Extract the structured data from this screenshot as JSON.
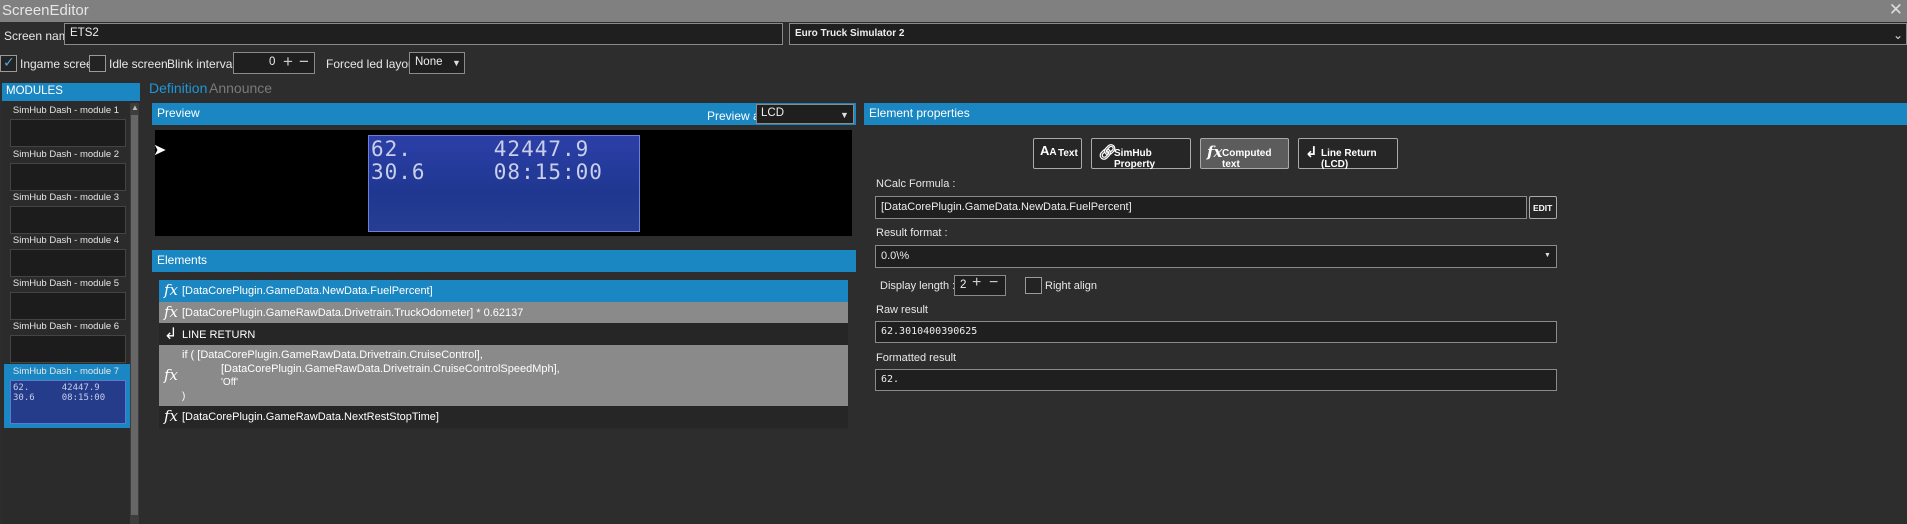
{
  "window": {
    "title": "ScreenEditor",
    "close_glyph": "✕"
  },
  "row1": {
    "screen_name_label": "Screen name",
    "screen_name_value": "ETS2",
    "game_value": "Euro Truck Simulator 2"
  },
  "row2": {
    "ingame_label": "Ingame screen",
    "ingame_checked": true,
    "idle_label": "Idle screen",
    "idle_checked": false,
    "blink_label": "Blink interval",
    "blink_value": "0",
    "forced_led_label": "Forced led layout",
    "forced_led_value": "None"
  },
  "modules": {
    "header": "MODULES",
    "items": [
      {
        "name": "SimHub Dash - module 1"
      },
      {
        "name": "SimHub Dash - module 2"
      },
      {
        "name": "SimHub Dash - module 3"
      },
      {
        "name": "SimHub Dash - module 4"
      },
      {
        "name": "SimHub Dash - module 5"
      },
      {
        "name": "SimHub Dash - module 6"
      },
      {
        "name": "SimHub Dash - module 7",
        "line1": "62.      42447.9",
        "line2": "30.6     08:15:00"
      }
    ]
  },
  "tabs": {
    "definition": "Definition",
    "announce": "Announce"
  },
  "preview": {
    "header": "Preview",
    "preview_as_label": "Preview as",
    "preview_as_value": "LCD",
    "lcd_line1": "62.      42447.9",
    "lcd_line2": "30.6     08:15:00"
  },
  "elements": {
    "header": "Elements",
    "rows": [
      {
        "text": "[DataCorePlugin.GameData.NewData.FuelPercent]"
      },
      {
        "text": "[DataCorePlugin.GameRawData.Drivetrain.TruckOdometer] * 0.62137"
      },
      {
        "text": "LINE RETURN"
      },
      {
        "line1": "if ( [DataCorePlugin.GameRawData.Drivetrain.CruiseControl],",
        "line2": "[DataCorePlugin.GameRawData.Drivetrain.CruiseControlSpeedMph],",
        "line3": "'Off'",
        "line4": ")"
      },
      {
        "text": "[DataCorePlugin.GameRawData.NextRestStopTime]"
      }
    ]
  },
  "properties": {
    "header": "Element properties",
    "buttons": {
      "text": "Text",
      "simhub": "SimHub Property",
      "computed": "Computed text",
      "line_return": "Line Return (LCD)"
    },
    "ncalc_label": "NCalc Formula :",
    "ncalc_value": "[DataCorePlugin.GameData.NewData.FuelPercent]",
    "edit_label": "EDIT",
    "result_format_label": "Result format :",
    "result_format_value": "0.0\\%",
    "display_length_label": "Display length :",
    "display_length_value": "2",
    "right_align_label": "Right align",
    "raw_result_label": "Raw result",
    "raw_result_value": "62.3010400390625",
    "formatted_result_label": "Formatted result",
    "formatted_result_value": "62."
  }
}
